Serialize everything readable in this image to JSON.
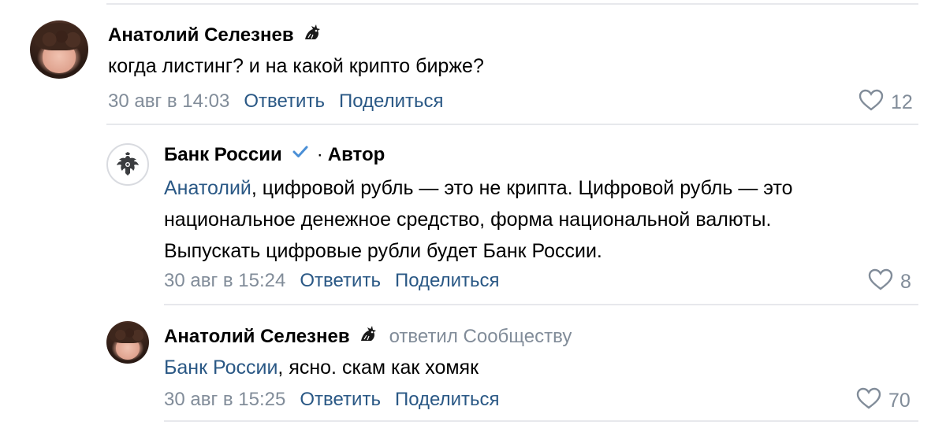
{
  "comments": [
    {
      "author": "Анатолий Селезнев",
      "badge_icon": "dragon-emoji-icon",
      "text": "когда листинг? и на какой крипто бирже?",
      "date": "30 авг в 14:03",
      "reply_label": "Ответить",
      "share_label": "Поделиться",
      "likes": "12"
    },
    {
      "author": "Банк России",
      "verified_icon": "verified-check-icon",
      "separator": "·",
      "author_label": "Автор",
      "mention": "Анатолий",
      "text_line1_rest": ", цифровой рубль — это не крипта. Цифровой рубль — это",
      "text_line2": "национальное денежное средство, форма национальной валюты.",
      "text_line3": "Выпускать цифровые рубли будет Банк России.",
      "date": "30 авг в 15:24",
      "reply_label": "Ответить",
      "share_label": "Поделиться",
      "likes": "8"
    },
    {
      "author": "Анатолий Селезнев",
      "badge_icon": "dragon-emoji-icon",
      "replied_label": "ответил Сообществу",
      "mention": "Банк России",
      "text_rest": ", ясно. скам как хомяк",
      "date": "30 авг в 15:25",
      "reply_label": "Ответить",
      "share_label": "Поделиться",
      "likes": "70"
    }
  ],
  "colors": {
    "link": "#2a5885",
    "secondary": "#818c99",
    "verified": "#4a8fd6",
    "divider": "#e7e8ec"
  }
}
